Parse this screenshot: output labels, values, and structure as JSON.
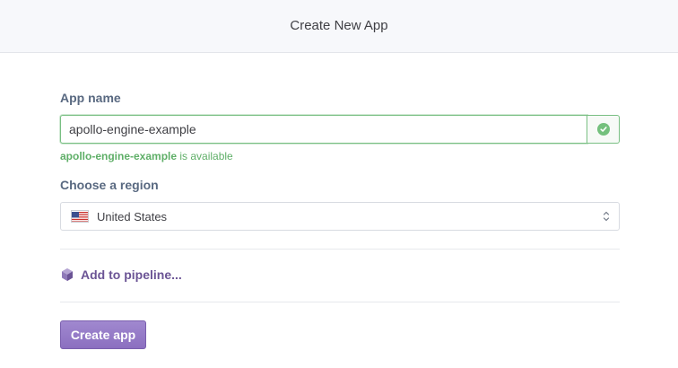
{
  "header": {
    "title": "Create New App"
  },
  "form": {
    "app_name_label": "App name",
    "app_name_value": "apollo-engine-example",
    "availability": {
      "name": "apollo-engine-example",
      "suffix": " is available"
    },
    "region_label": "Choose a region",
    "region_value": "United States",
    "region_flag_icon": "us-flag-icon",
    "pipeline_link": "Add to pipeline...",
    "pipeline_icon": "pipeline-hexagon-icon",
    "submit_label": "Create app"
  },
  "colors": {
    "accent_purple": "#8b6fc0",
    "success_green": "#74c07d",
    "label_slate": "#596981",
    "header_background": "#f7f8fb"
  }
}
